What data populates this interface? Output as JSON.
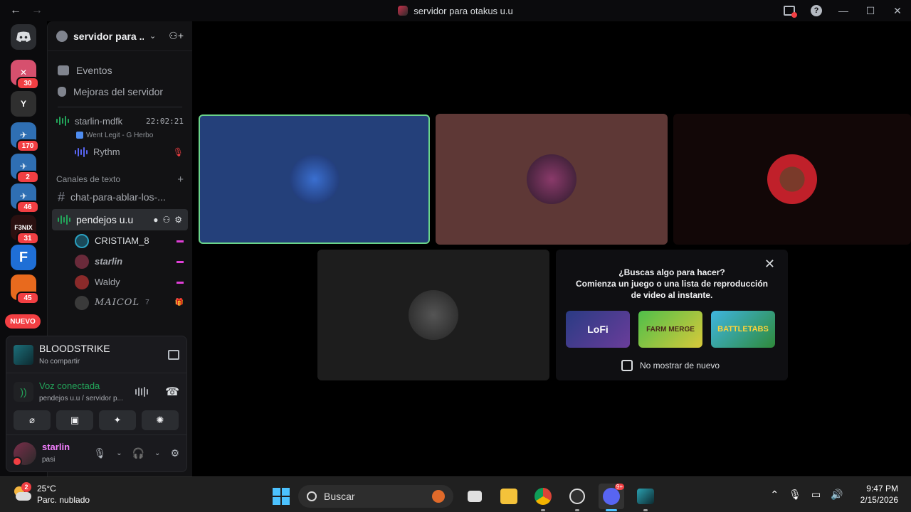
{
  "window": {
    "title": "servidor para otakus u.u",
    "back": "←",
    "forward": "→",
    "minimize": "—",
    "maximize": "☐",
    "close": "✕",
    "help": "?"
  },
  "rail": {
    "servers": [
      {
        "name": "discord-home",
        "badge": "",
        "color": "#2b2d31"
      },
      {
        "name": "server-1",
        "badge": "30",
        "color": "#d6506e"
      },
      {
        "name": "server-2",
        "badge": "",
        "color": "#3a3a3a"
      },
      {
        "name": "server-3",
        "badge": "170",
        "color": "#2f6fb3"
      },
      {
        "name": "server-4",
        "badge": "2",
        "color": "#2f6fb3"
      },
      {
        "name": "server-5",
        "badge": "46",
        "color": "#2f6fb3"
      },
      {
        "name": "server-6",
        "badge": "31",
        "color": "#2a1010"
      },
      {
        "name": "server-7",
        "badge": "",
        "color": "#1f6fd6"
      },
      {
        "name": "server-8",
        "badge": "45",
        "color": "#e86a1e"
      }
    ],
    "server6_text": "F3NIX",
    "server7_text": "F",
    "nuevo_label": "NUEVO"
  },
  "sidebar": {
    "server_name": "servidor para ...",
    "events_label": "Eventos",
    "boost_label": "Mejoras del servidor",
    "stage": {
      "user": "starlin-mdfk",
      "time": "22:02:21",
      "song": "Went Legit - G Herbo",
      "bot": "Rythm"
    },
    "category_label": "Canales de texto",
    "text_channel": "chat-para-ablar-los-...",
    "voice_channel": "pendejos u.u",
    "members": [
      {
        "name": "CRISTIAM_8",
        "color": "#1a4a5a"
      },
      {
        "name": "starlin",
        "color": "#6a2a3a"
      },
      {
        "name": "Waldy",
        "color": "#8a2a2a"
      },
      {
        "name": "MAICOL",
        "color": "#3a3a3a"
      }
    ],
    "maicol_count": "7"
  },
  "panel": {
    "game_title": "BLOODSTRIKE",
    "game_sub": "No compartir",
    "voice_status": "Voz conectada",
    "voice_location": "pendejos u.u / servidor p...",
    "user_name": "starlin",
    "user_status": "pasi"
  },
  "promo": {
    "line1": "¿Buscas algo para hacer?",
    "line2": "Comienza un juego o una lista de reproducción",
    "line3": "de video al instante.",
    "cards": [
      "LoFi",
      "FARM MERGE",
      "BATTLETABS"
    ],
    "checkbox_label": "No mostrar de nuevo"
  },
  "taskbar": {
    "temp": "25°C",
    "condition": "Parc. nublado",
    "weather_badge": "2",
    "search_placeholder": "Buscar",
    "time": "9:47 PM",
    "date": "2/15/2026",
    "discord_badge": "9+"
  }
}
